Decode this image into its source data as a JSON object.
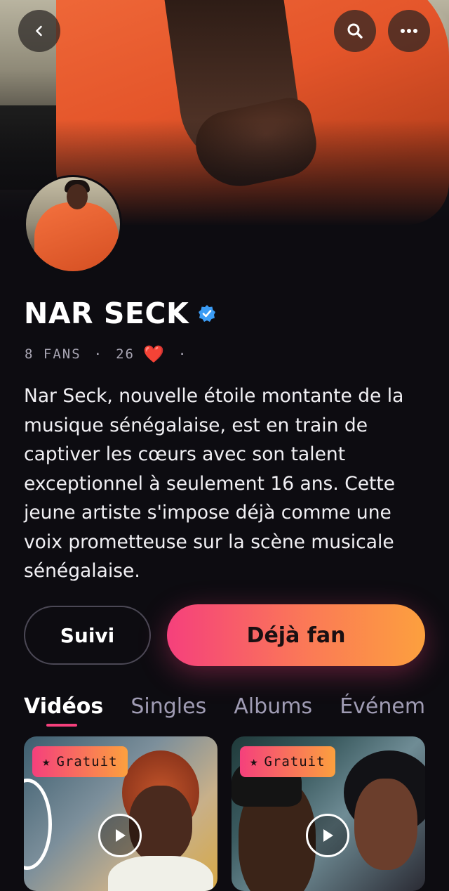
{
  "header": {
    "back_icon": "chevron-left-icon",
    "search_icon": "search-icon",
    "more_icon": "more-horizontal-icon"
  },
  "artist": {
    "name": "NAR SECK",
    "verified_icon": "verified-badge-icon",
    "verified_color": "#3b9cf5",
    "fans": "8 FANS",
    "likes": "26",
    "heart_glyph": "❤️",
    "bio": "Nar Seck, nouvelle étoile montante de la musique sénégalaise, est en train de captiver les cœurs avec son talent exceptionnel à seulement 16 ans. Cette jeune artiste s'impose déjà comme une voix prometteuse sur la scène musicale sénégalaise."
  },
  "actions": {
    "follow_label": "Suivi",
    "fan_label": "Déjà fan"
  },
  "tabs": [
    {
      "label": "Vidéos",
      "active": true
    },
    {
      "label": "Singles",
      "active": false
    },
    {
      "label": "Albums",
      "active": false
    },
    {
      "label": "Événements",
      "active": false
    }
  ],
  "videos": [
    {
      "badge": "Gratuit",
      "star": "★"
    },
    {
      "badge": "Gratuit",
      "star": "★"
    }
  ],
  "colors": {
    "background": "#0d0c11",
    "accent_pink": "#f5407c",
    "accent_orange": "#fca03e"
  }
}
